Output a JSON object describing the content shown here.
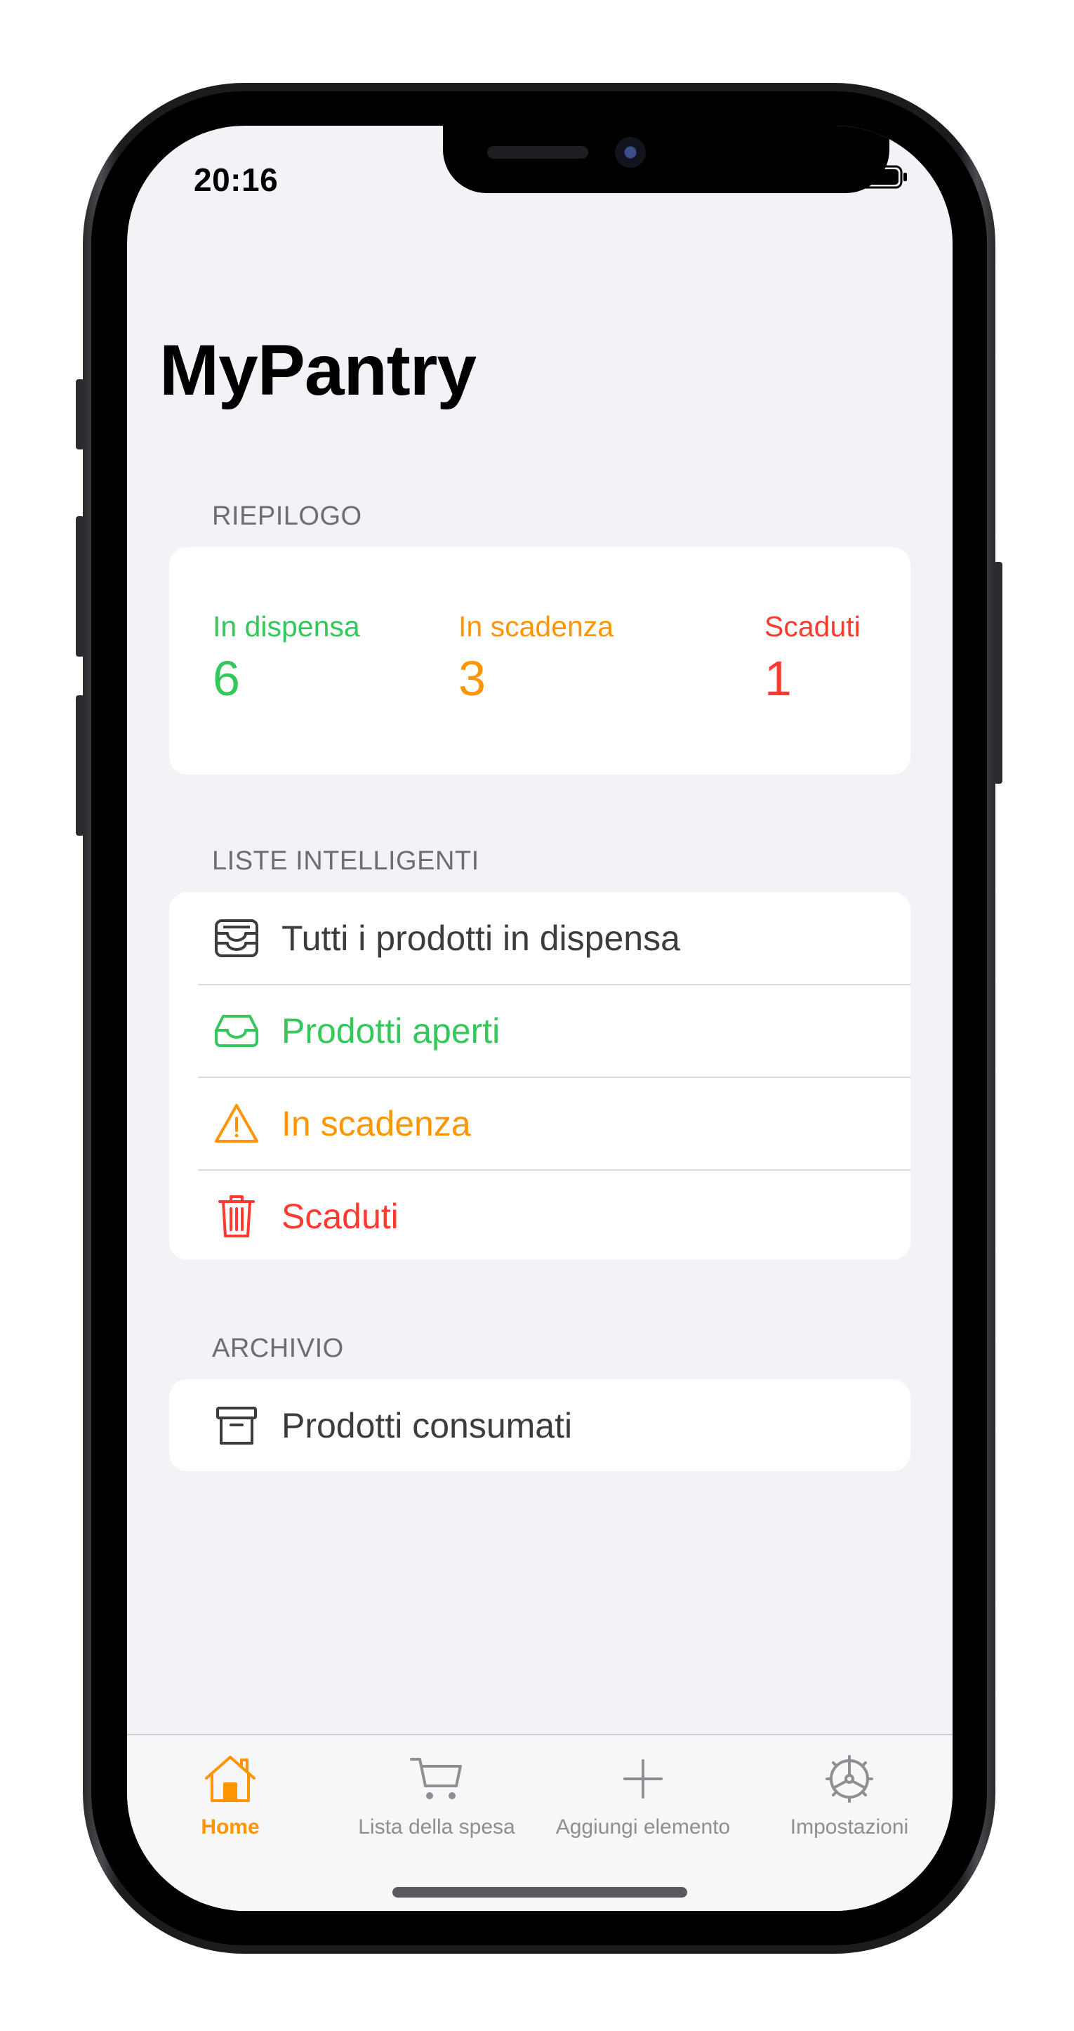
{
  "status_bar": {
    "time": "20:16"
  },
  "title": "MyPantry",
  "summary": {
    "header": "RIEPILOGO",
    "items": [
      {
        "label": "In dispensa",
        "value": "6",
        "color": "#34c759"
      },
      {
        "label": "In scadenza",
        "value": "3",
        "color": "#ff9500"
      },
      {
        "label": "Scaduti",
        "value": "1",
        "color": "#ff3b30"
      }
    ]
  },
  "smart_lists": {
    "header": "LISTE INTELLIGENTI",
    "items": [
      {
        "label": "Tutti i prodotti in dispensa",
        "icon": "tray-full-icon",
        "color": "#3c3c3f"
      },
      {
        "label": "Prodotti aperti",
        "icon": "tray-icon",
        "color": "#34c759"
      },
      {
        "label": "In scadenza",
        "icon": "warning-icon",
        "color": "#ff9500"
      },
      {
        "label": "Scaduti",
        "icon": "trash-icon",
        "color": "#ff3b30"
      }
    ]
  },
  "archive": {
    "header": "ARCHIVIO",
    "items": [
      {
        "label": "Prodotti consumati",
        "icon": "archive-box-icon",
        "color": "#3c3c3f"
      }
    ]
  },
  "tab_bar": {
    "active": "Home",
    "accent": "#ff9500",
    "tabs": [
      {
        "label": "Home",
        "icon": "house-icon"
      },
      {
        "label": "Lista della spesa",
        "icon": "cart-icon"
      },
      {
        "label": "Aggiungi elemento",
        "icon": "plus-icon"
      },
      {
        "label": "Impostazioni",
        "icon": "gear-icon"
      }
    ]
  }
}
